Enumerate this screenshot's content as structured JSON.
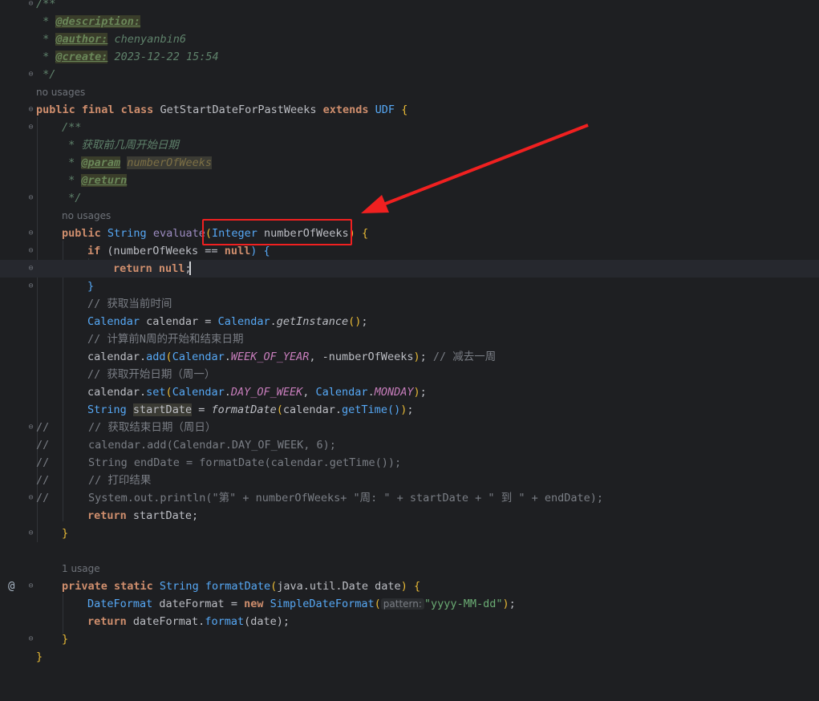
{
  "colors": {
    "background": "#1e1f22",
    "keyword": "#cf8e6d",
    "string": "#6aab73",
    "comment": "#7a7e85",
    "doc_comment": "#5f826b",
    "annotation_box": "#f02020"
  },
  "usage_hints": {
    "no_usages_1": "no usages",
    "no_usages_2": "no usages",
    "one_usage": "1 usage"
  },
  "param_hint": "pattern:",
  "lines": {
    "l1": "/**",
    "l2_star": " * ",
    "l2_tag": "@description:",
    "l3_tag": "@author:",
    "l3_val": " chenyanbin6",
    "l4_tag": "@create:",
    "l4_val": " 2023-12-22 15:54",
    "l5": " */",
    "class_decl_kw": "public final class",
    "class_name": " GetStartDateForPastWeeks",
    "extends_kw": " extends",
    "parent": " UDF",
    "brace_open": " {",
    "doc_open": "/**",
    "doc_cn": " * 获取前几周开始日期",
    "doc_param_tag": "@param",
    "doc_param_name": "numberOfWeeks",
    "doc_return_tag": "@return",
    "doc_close": " */",
    "method_kw": "public",
    "method_ret": " String",
    "method_name": " evaluate",
    "method_param_type": "Integer",
    "method_param_name": " numberOfWeeks",
    "if_kw": "if",
    "if_cond": " (numberOfWeeks == ",
    "null1": "null",
    "if_close": ") {",
    "return_kw": "return",
    "null2": " null",
    "semi": ";",
    "close_brace": "}",
    "cmt_get_time": "// 获取当前时间",
    "cal_type": "Calendar",
    "cal_decl": " calendar = ",
    "cal_class": "Calendar",
    "get_instance": "getInstance",
    "cmt_calc": "// 计算前N周的开始和结束日期",
    "add_call": "calendar.",
    "add_fn": "add",
    "week_of_year": "WEEK_OF_YEAR",
    "neg_weeks": ", -numberOfWeeks",
    "cmt_minus": "// 减去一周",
    "cmt_get_start": "// 获取开始日期（周一）",
    "set_fn": "set",
    "day_of_week": "DAY_OF_WEEK",
    "monday": "MONDAY",
    "string_type": "String",
    "start_date": "startDate",
    "format_date_call": "formatDate",
    "get_time": "getTime",
    "c1": "//",
    "c1_body": "      // 获取结束日期（周日）",
    "c2": "//",
    "c2_body": "      calendar.add(Calendar.DAY_OF_WEEK, 6);",
    "c3": "//",
    "c3_body": "      String endDate = formatDate(calendar.getTime());",
    "c4": "//",
    "c4_body": "      // 打印结果",
    "c5": "//",
    "c5_body": "      System.out.println(\"第\" + numberOfWeeks+ \"周: \" + startDate + \" 到 \" + endDate);",
    "return_start": " startDate;",
    "private_kw": "private static",
    "fd_ret": " String",
    "fd_name": " formatDate",
    "fd_params": "java.util.Date date",
    "df_type": "DateFormat",
    "df_decl": " dateFormat = ",
    "new_kw": "new",
    "sdf": " SimpleDateFormat",
    "pattern_str": "\"yyyy-MM-dd\"",
    "ret_format": " dateFormat.",
    "format_fn": "format",
    "ret_args": "(date);"
  },
  "gutter": {
    "override_marker": "@"
  }
}
